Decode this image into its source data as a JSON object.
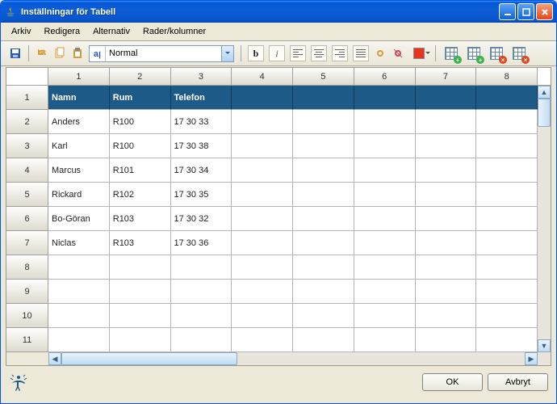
{
  "window": {
    "title": "Inställningar för Tabell"
  },
  "menu": {
    "items": [
      "Arkiv",
      "Redigera",
      "Alternativ",
      "Rader/kolumner"
    ]
  },
  "toolbar": {
    "style_selected": "Normal"
  },
  "grid": {
    "col_headers": [
      "1",
      "2",
      "3",
      "4",
      "5",
      "6",
      "7",
      "8"
    ],
    "row_headers": [
      "1",
      "2",
      "3",
      "4",
      "5",
      "6",
      "7",
      "8",
      "9",
      "10",
      "11"
    ],
    "rows": [
      {
        "header": true,
        "cells": [
          "Namn",
          "Rum",
          "Telefon",
          "",
          "",
          "",
          "",
          ""
        ]
      },
      {
        "header": false,
        "cells": [
          "Anders",
          "R100",
          "17 30 33",
          "",
          "",
          "",
          "",
          ""
        ]
      },
      {
        "header": false,
        "cells": [
          "Karl",
          "R100",
          "17 30 38",
          "",
          "",
          "",
          "",
          ""
        ]
      },
      {
        "header": false,
        "cells": [
          "Marcus",
          "R101",
          "17 30 34",
          "",
          "",
          "",
          "",
          ""
        ]
      },
      {
        "header": false,
        "cells": [
          "Rickard",
          "R102",
          "17 30 35",
          "",
          "",
          "",
          "",
          ""
        ]
      },
      {
        "header": false,
        "cells": [
          "Bo-Göran",
          "R103",
          "17 30 32",
          "",
          "",
          "",
          "",
          ""
        ]
      },
      {
        "header": false,
        "cells": [
          "Niclas",
          "R103",
          "17 30 36",
          "",
          "",
          "",
          "",
          ""
        ]
      },
      {
        "header": false,
        "cells": [
          "",
          "",
          "",
          "",
          "",
          "",
          "",
          ""
        ]
      },
      {
        "header": false,
        "cells": [
          "",
          "",
          "",
          "",
          "",
          "",
          "",
          ""
        ]
      },
      {
        "header": false,
        "cells": [
          "",
          "",
          "",
          "",
          "",
          "",
          "",
          ""
        ]
      },
      {
        "header": false,
        "cells": [
          "",
          "",
          "",
          "",
          "",
          "",
          "",
          ""
        ]
      }
    ]
  },
  "buttons": {
    "ok": "OK",
    "cancel": "Avbryt"
  }
}
